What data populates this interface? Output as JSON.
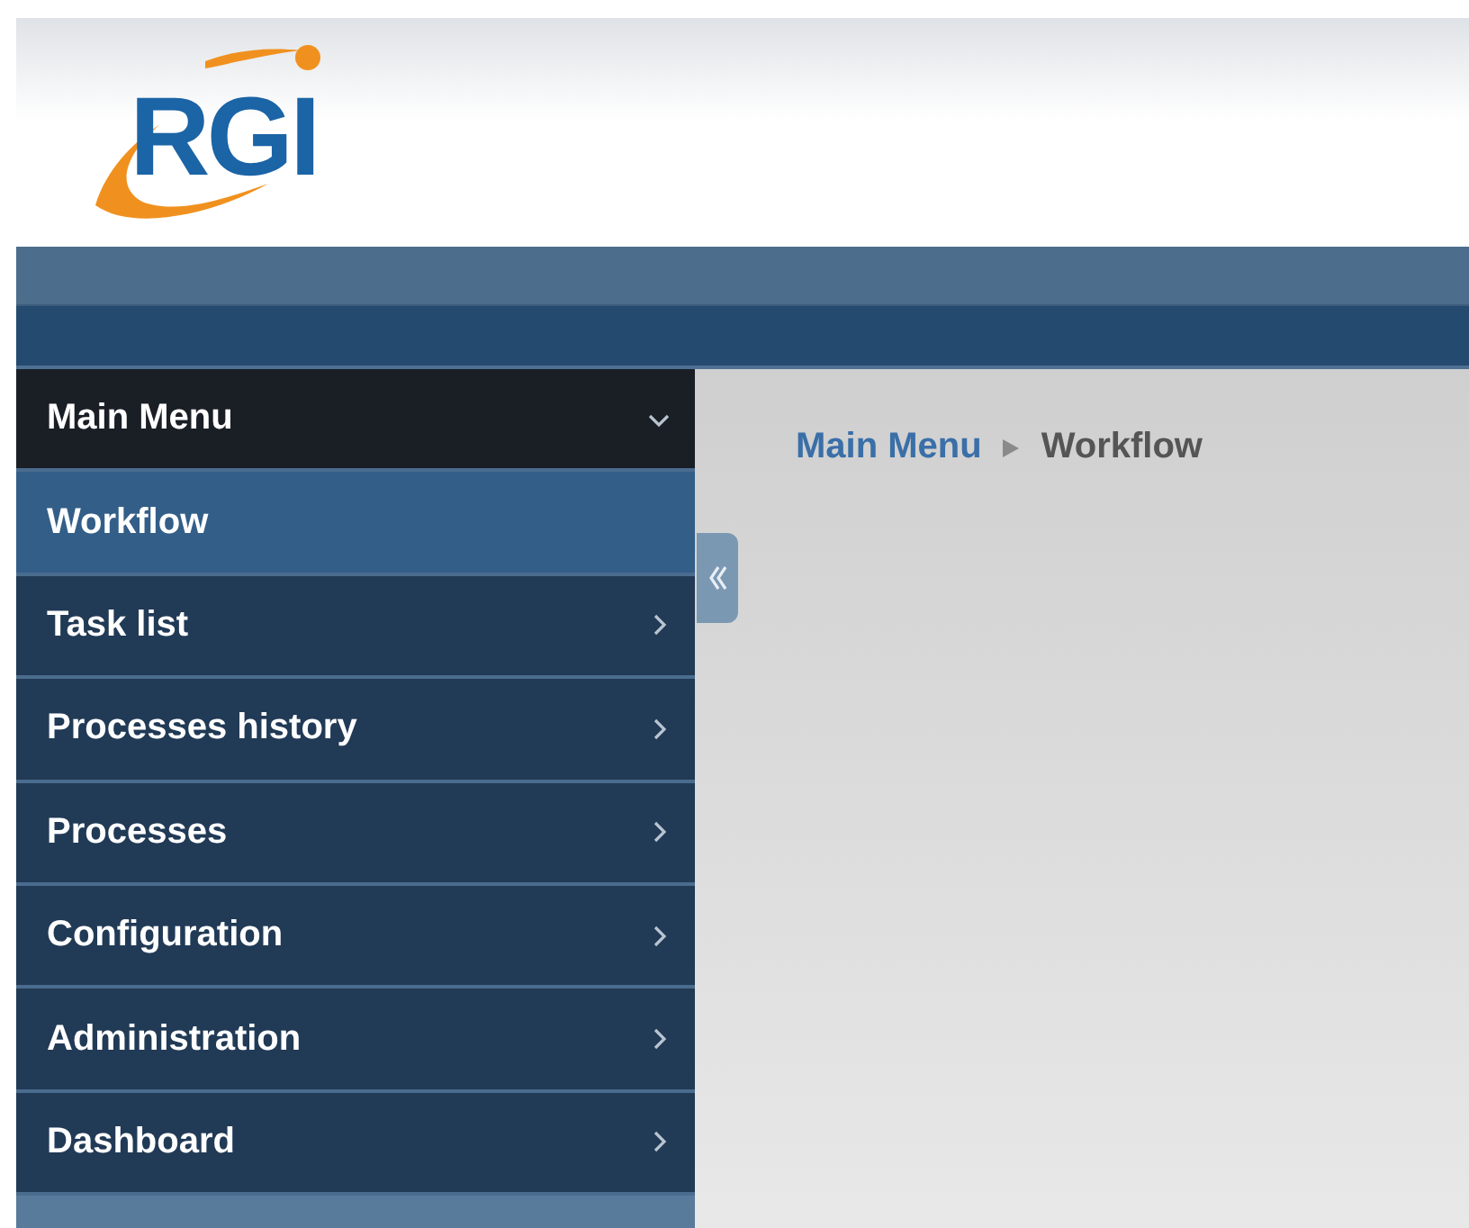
{
  "logo": {
    "text": "RGI"
  },
  "sidebar": {
    "header": {
      "label": "Main Menu",
      "expanded": true
    },
    "items": [
      {
        "label": "Workflow",
        "selected": true
      },
      {
        "label": "Task list",
        "selected": false
      },
      {
        "label": "Processes history",
        "selected": false
      },
      {
        "label": "Processes",
        "selected": false
      },
      {
        "label": "Configuration",
        "selected": false
      },
      {
        "label": "Administration",
        "selected": false
      },
      {
        "label": "Dashboard",
        "selected": false
      }
    ]
  },
  "breadcrumb": [
    {
      "label": "Main Menu",
      "kind": "link"
    },
    {
      "label": "Workflow",
      "kind": "current"
    }
  ]
}
